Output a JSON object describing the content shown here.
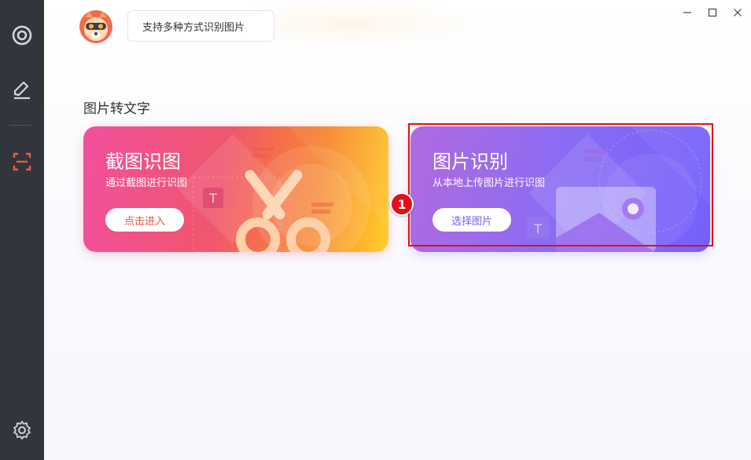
{
  "sidebar": {
    "items": [
      {
        "icon": "target-icon"
      },
      {
        "icon": "edit-icon"
      },
      {
        "icon": "scan-icon",
        "active": true
      }
    ],
    "settings_icon": "gear-icon"
  },
  "header": {
    "bubble_text": "支持多种方式识别图片"
  },
  "window_controls": {
    "minimize": "—",
    "maximize": "☐",
    "close": "✕"
  },
  "section": {
    "title": "图片转文字",
    "cards": [
      {
        "title": "截图识图",
        "subtitle": "通过截图进行识图",
        "button": "点击进入",
        "icon": "scissors-icon"
      },
      {
        "title": "图片识别",
        "subtitle": "从本地上传图片进行识图",
        "button": "选择图片",
        "icon": "image-icon"
      }
    ]
  },
  "annotation": {
    "step_number": "1"
  },
  "colors": {
    "sidebar_bg": "#32353c",
    "scan_icon_accent": "#f05a45",
    "left_button_text": "#e9553a",
    "right_button_text": "#7a5cf0",
    "highlight_border": "#e01010"
  }
}
